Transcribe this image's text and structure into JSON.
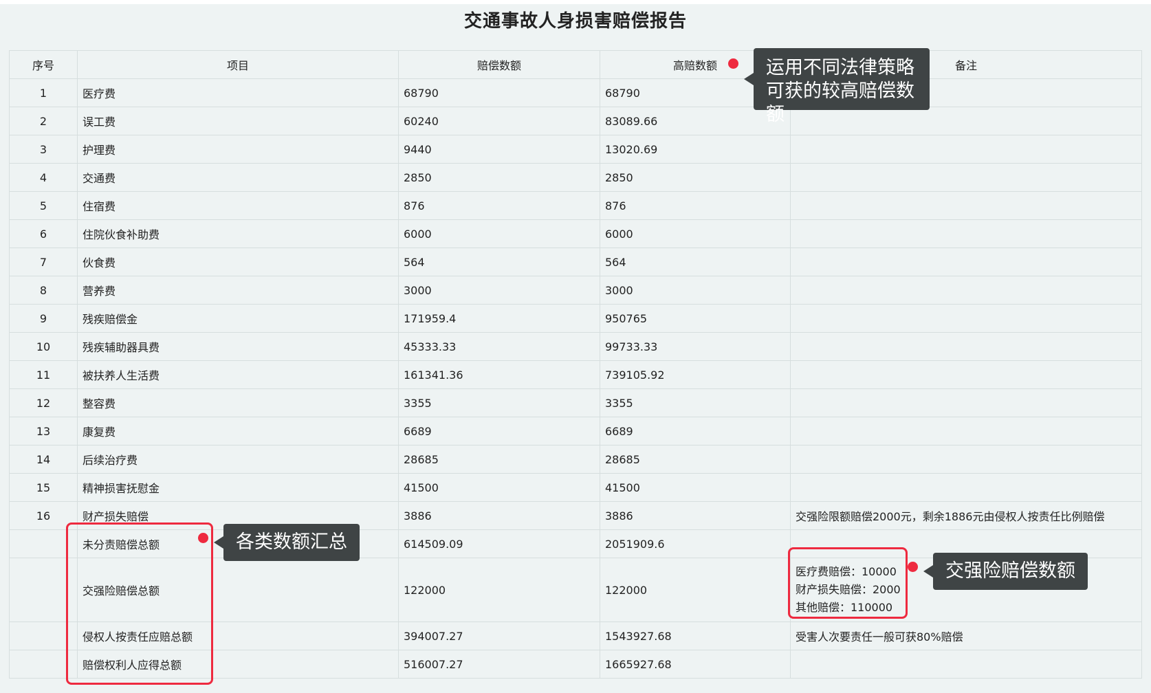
{
  "report": {
    "title": "交通事故人身损害赔偿报告",
    "columns": {
      "idx": "序号",
      "item": "项目",
      "amount": "赔偿数额",
      "high": "高赔数额",
      "note": "备注"
    },
    "rows": [
      {
        "idx": "1",
        "item": "医疗费",
        "amount": "68790",
        "high": "68790",
        "note": ""
      },
      {
        "idx": "2",
        "item": "误工费",
        "amount": "60240",
        "high": "83089.66",
        "note": ""
      },
      {
        "idx": "3",
        "item": "护理费",
        "amount": "9440",
        "high": "13020.69",
        "note": ""
      },
      {
        "idx": "4",
        "item": "交通费",
        "amount": "2850",
        "high": "2850",
        "note": ""
      },
      {
        "idx": "5",
        "item": "住宿费",
        "amount": "876",
        "high": "876",
        "note": ""
      },
      {
        "idx": "6",
        "item": "住院伙食补助费",
        "amount": "6000",
        "high": "6000",
        "note": ""
      },
      {
        "idx": "7",
        "item": "伙食费",
        "amount": "564",
        "high": "564",
        "note": ""
      },
      {
        "idx": "8",
        "item": "营养费",
        "amount": "3000",
        "high": "3000",
        "note": ""
      },
      {
        "idx": "9",
        "item": "残疾赔偿金",
        "amount": "171959.4",
        "high": "950765",
        "note": ""
      },
      {
        "idx": "10",
        "item": "残疾辅助器具费",
        "amount": "45333.33",
        "high": "99733.33",
        "note": ""
      },
      {
        "idx": "11",
        "item": "被扶养人生活费",
        "amount": "161341.36",
        "high": "739105.92",
        "note": ""
      },
      {
        "idx": "12",
        "item": "整容费",
        "amount": "3355",
        "high": "3355",
        "note": ""
      },
      {
        "idx": "13",
        "item": "康复费",
        "amount": "6689",
        "high": "6689",
        "note": ""
      },
      {
        "idx": "14",
        "item": "后续治疗费",
        "amount": "28685",
        "high": "28685",
        "note": ""
      },
      {
        "idx": "15",
        "item": "精神损害抚慰金",
        "amount": "41500",
        "high": "41500",
        "note": ""
      },
      {
        "idx": "16",
        "item": "财产损失赔偿",
        "amount": "3886",
        "high": "3886",
        "note": "交强险限额赔偿2000元，剩余1886元由侵权人按责任比例赔偿"
      }
    ],
    "summary": {
      "unassigned": {
        "item": "未分责赔偿总额",
        "amount": "614509.09",
        "high": "2051909.6"
      },
      "compulsory": {
        "item": "交强险赔偿总额",
        "amount": "122000",
        "high": "122000",
        "note_lines": [
          "医疗费赔偿：10000",
          "财产损失赔偿：2000",
          "其他赔偿：110000"
        ]
      },
      "tortfeasor": {
        "item": "侵权人按责任应赔总额",
        "amount": "394007.27",
        "high": "1543927.68",
        "note": "受害人次要责任一般可获80%赔偿"
      },
      "claimant": {
        "item": "赔偿权利人应得总额",
        "amount": "516007.27",
        "high": "1665927.68"
      }
    }
  },
  "annotations": {
    "high_amount": {
      "line1": "运用不同法律策略",
      "line2": "可获的较高赔偿数额"
    },
    "summary": "各类数额汇总",
    "compulsory": "交强险赔偿数额"
  },
  "colors": {
    "marker": "#ee2a3f",
    "callout_bg": "#3f4445",
    "background": "#eef3f3"
  }
}
